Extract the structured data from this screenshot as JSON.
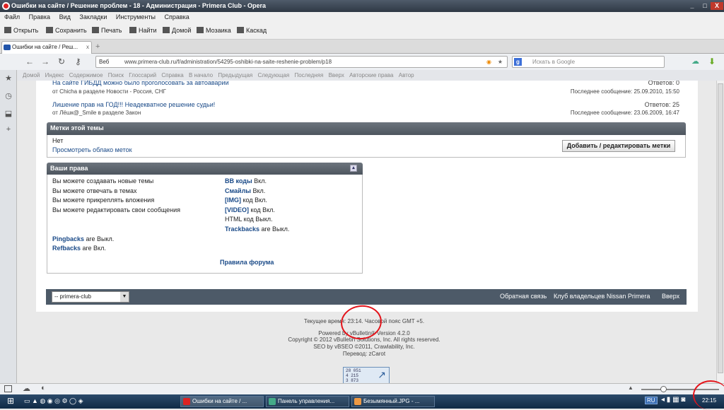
{
  "window": {
    "title": "Ошибки на сайте / Решение проблем - 18 - Администрация - Primera Club - Opera",
    "buttons": {
      "minimize": "_",
      "maximize": "□",
      "close": "X"
    }
  },
  "menu": [
    "Файл",
    "Правка",
    "Вид",
    "Закладки",
    "Инструменты",
    "Справка"
  ],
  "toolbar": [
    "Открыть",
    "Сохранить",
    "Печать",
    "Найти",
    "Домой",
    "Мозаика",
    "Каскад"
  ],
  "tab": {
    "label": "Ошибки на сайте / Реш...",
    "close": "x",
    "new": "+"
  },
  "address": {
    "web_label": "Веб",
    "url": "www.primera-club.ru/f/administration/54295-oshibki-na-saite-reshenie-problem/p18",
    "search_placeholder": "Искать в Google",
    "search_engine": "g"
  },
  "bookmarks": [
    "Домой",
    "Индекс",
    "Содержимое",
    "Поиск",
    "Глоссарий",
    "Справка",
    "В начало",
    "Предыдущая",
    "Следующая",
    "Последняя",
    "Вверх",
    "Авторские права",
    "Автор"
  ],
  "similar_threads": [
    {
      "title": "На сайте ГИБДД можно было проголосовать за автоаварии",
      "by": "от Chicha в разделе Новости - Россия, СНГ",
      "replies": "Ответов: 0",
      "last": "Последнее сообщение: 25.09.2010, 15:50"
    },
    {
      "title": "Лишение прав на ГОД!!! Неадекватное решение судьи!",
      "by": "от Лёшк@_Smile в разделе Закон",
      "replies": "Ответов: 25",
      "last": "Последнее сообщение: 23.06.2009, 16:47"
    }
  ],
  "tags": {
    "header": "Метки этой темы",
    "none": "Нет",
    "cloud_link": "Просмотреть облако меток",
    "edit_button": "Добавить / редактировать метки"
  },
  "rights": {
    "header": "Ваши права",
    "left": [
      "Вы можете создавать новые темы",
      "Вы можете отвечать в темах",
      "Вы можете прикреплять вложения",
      "Вы можете редактировать свои сообщения"
    ],
    "right": [
      {
        "link": "BB коды",
        "suffix": " Вкл."
      },
      {
        "link": "Смайлы",
        "suffix": " Вкл."
      },
      {
        "link": "[IMG]",
        "suffix": " код Вкл."
      },
      {
        "link": "[VIDEO]",
        "suffix": " код Вкл."
      },
      {
        "link": "",
        "suffix": "HTML код Выкл."
      },
      {
        "link": "Trackbacks",
        "suffix": " are Выкл."
      }
    ],
    "pingbacks": {
      "link": "Pingbacks",
      "suffix": " are Выкл."
    },
    "refbacks": {
      "link": "Refbacks",
      "suffix": " are Вкл."
    },
    "rules": "Правила форума"
  },
  "footer": {
    "style_select": "-- primera-club",
    "links": [
      "Обратная связь",
      "Клуб владельцев Nissan Primera",
      "Вверх"
    ]
  },
  "credits": {
    "time": "Текущее время: 23:14. Часовой пояс GMT +5.",
    "powered": "Powered by vBulletin® Version 4.2.0",
    "copyright": "Copyright © 2012 vBulletin Solutions, Inc. All rights reserved.",
    "seo": "SEO by vBSEO ©2011, Crawlability, Inc.",
    "translation": "Перевод: zCarot",
    "counter": [
      "28 051",
      "4 215",
      "3 873"
    ]
  },
  "taskbar": {
    "tasks": [
      "Ошибки на сайте / ...",
      "Панель управления...",
      "Безымянный.JPG - ..."
    ],
    "lang": "RU",
    "clock": "22:15"
  }
}
